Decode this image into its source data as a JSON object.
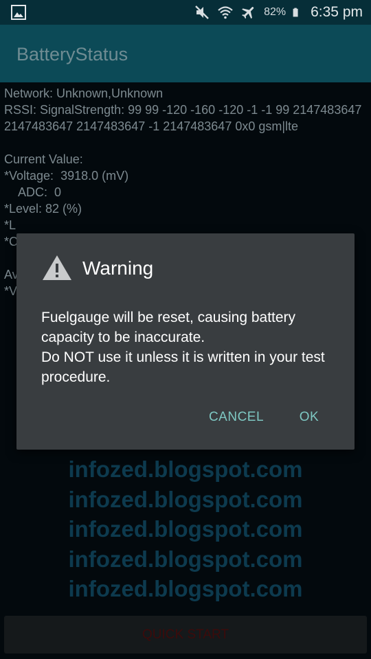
{
  "status_bar": {
    "battery_percent": "82%",
    "time": "6:35 pm",
    "icons": [
      "gallery-icon",
      "mute-icon",
      "wifi-icon",
      "airplane-icon",
      "battery-icon"
    ]
  },
  "app": {
    "title": "BatteryStatus"
  },
  "info": {
    "network": "Network: Unknown,Unknown",
    "rssi": "RSSI: SignalStrength: 99 99 -120 -160 -120 -1 -1 99 2147483647 2147483647 2147483647 -1 2147483647 0x0 gsm|lte",
    "current_value": "Current Value:",
    "voltage": "*Voltage:  3918.0 (mV)",
    "adc": "ADC:  0",
    "level": "*Level: 82 (%)",
    "row5": "*L",
    "row6": "*C",
    "row7": "Av",
    "row8": "*V"
  },
  "watermark": {
    "lines": [
      "infozed.blogspot.com",
      "infozed.blogspot.com",
      "infozed.blogspot.com",
      "infozed.blogspot.com",
      "infozed.blogspot.com"
    ]
  },
  "quick_start": {
    "label": "QUICK START"
  },
  "dialog": {
    "title": "Warning",
    "message_1": "Fuelgauge will be reset, causing battery capacity to be inaccurate.",
    "message_2": "Do NOT use it unless it is written in your test procedure.",
    "cancel_label": "CANCEL",
    "ok_label": "OK"
  },
  "colors": {
    "status_bar": "#062e38",
    "action_bar": "#0c4a57",
    "dialog_bg": "#393d40",
    "button_text": "#7ec8c3",
    "quick_start_text": "#3c0b0b"
  }
}
